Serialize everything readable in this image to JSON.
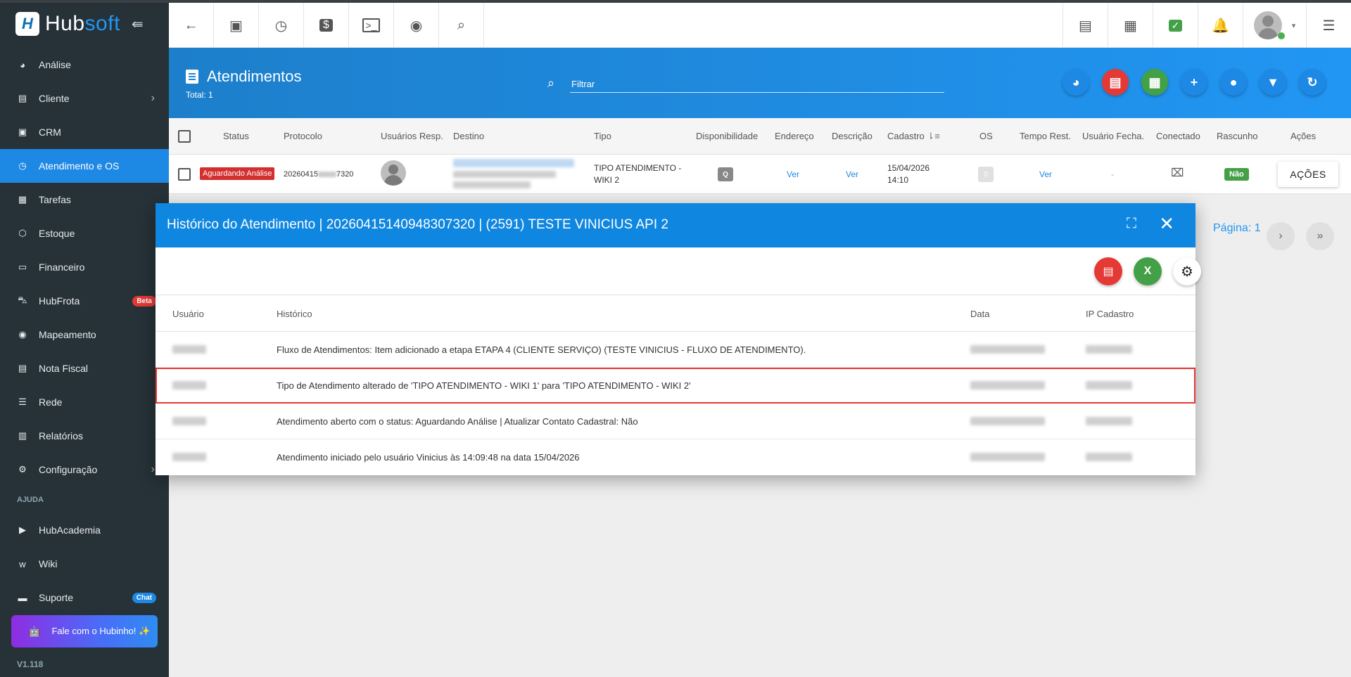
{
  "brand": {
    "hub": "Hub",
    "soft": "soft",
    "logo": "H",
    "collapse_icon": "collapse-icon"
  },
  "sidebar": {
    "items": [
      {
        "label": "Análise",
        "icon": "pie-chart-icon"
      },
      {
        "label": "Cliente",
        "icon": "contact-card-icon",
        "chevron": true
      },
      {
        "label": "CRM",
        "icon": "crm-icon"
      },
      {
        "label": "Atendimento e OS",
        "icon": "calendar-clock-icon",
        "active": true
      },
      {
        "label": "Tarefas",
        "icon": "tasks-icon"
      },
      {
        "label": "Estoque",
        "icon": "box-icon"
      },
      {
        "label": "Financeiro",
        "icon": "money-icon"
      },
      {
        "label": "HubFrota",
        "icon": "car-icon",
        "badge": "Beta"
      },
      {
        "label": "Mapeamento",
        "icon": "map-pin-icon"
      },
      {
        "label": "Nota Fiscal",
        "icon": "receipt-icon"
      },
      {
        "label": "Rede",
        "icon": "network-icon"
      },
      {
        "label": "Relatórios",
        "icon": "report-icon"
      },
      {
        "label": "Configuração",
        "icon": "gear-icon",
        "chevron": true
      }
    ],
    "section_help": "AJUDA",
    "help_items": [
      {
        "label": "HubAcademia",
        "icon": "youtube-icon"
      },
      {
        "label": "Wiki",
        "icon": "wiki-icon"
      },
      {
        "label": "Suporte",
        "icon": "chat-icon",
        "badge": "Chat"
      }
    ],
    "hubinho": "Fale com o Hubinho! ✨",
    "version": "V1.118"
  },
  "page": {
    "title": "Atendimentos",
    "total": "Total: 1",
    "filter_placeholder": "Filtrar"
  },
  "table": {
    "headers": [
      "Status",
      "Protocolo",
      "Usuários Resp.",
      "Destino",
      "Tipo",
      "Disponibilidade",
      "Endereço",
      "Descrição",
      "Cadastro",
      "OS",
      "Tempo Rest.",
      "Usuário Fecha.",
      "Conectado",
      "Rascunho",
      "Ações"
    ],
    "row": {
      "status": "Aguardando Análise",
      "protocolo": "20260415140948307320",
      "protocolo_visible_start": "20260415",
      "protocolo_visible_end": "7320",
      "tipo_line1": "TIPO ATENDIMENTO -",
      "tipo_line2": "WIKI 2",
      "disponibilidade": "Q",
      "endereco": "Ver",
      "descricao": "Ver",
      "cadastro_date": "15/04/2026",
      "cadastro_time": "14:10",
      "os": "0",
      "tempo_rest": "Ver",
      "usuario_fecha": "-",
      "rascunho": "Não",
      "acoes": "AÇÕES"
    }
  },
  "pagination": {
    "label": "Página: 1"
  },
  "modal": {
    "title": "Histórico do Atendimento | 20260415140948307320 | (2591) TESTE VINICIUS API 2",
    "headers": {
      "usuario": "Usuário",
      "historico": "Histórico",
      "data": "Data",
      "ip": "IP Cadastro"
    },
    "rows": [
      {
        "historico": "Fluxo de Atendimentos: Item adicionado a etapa ETAPA 4 (CLIENTE SERVIÇO) (TESTE VINICIUS - FLUXO DE ATENDIMENTO)."
      },
      {
        "historico": "Tipo de Atendimento alterado de 'TIPO ATENDIMENTO - WIKI 1' para 'TIPO ATENDIMENTO - WIKI 2'",
        "highlighted": true
      },
      {
        "historico": "Atendimento aberto com o status: Aguardando Análise | Atualizar Contato Cadastral: Não"
      },
      {
        "historico": "Atendimento iniciado pelo usuário Vinicius às 14:09:48 na data 15/04/2026"
      }
    ]
  },
  "colors": {
    "primary": "#1e88e5",
    "sidebar": "#263238",
    "danger": "#e53935",
    "success": "#43a047"
  }
}
